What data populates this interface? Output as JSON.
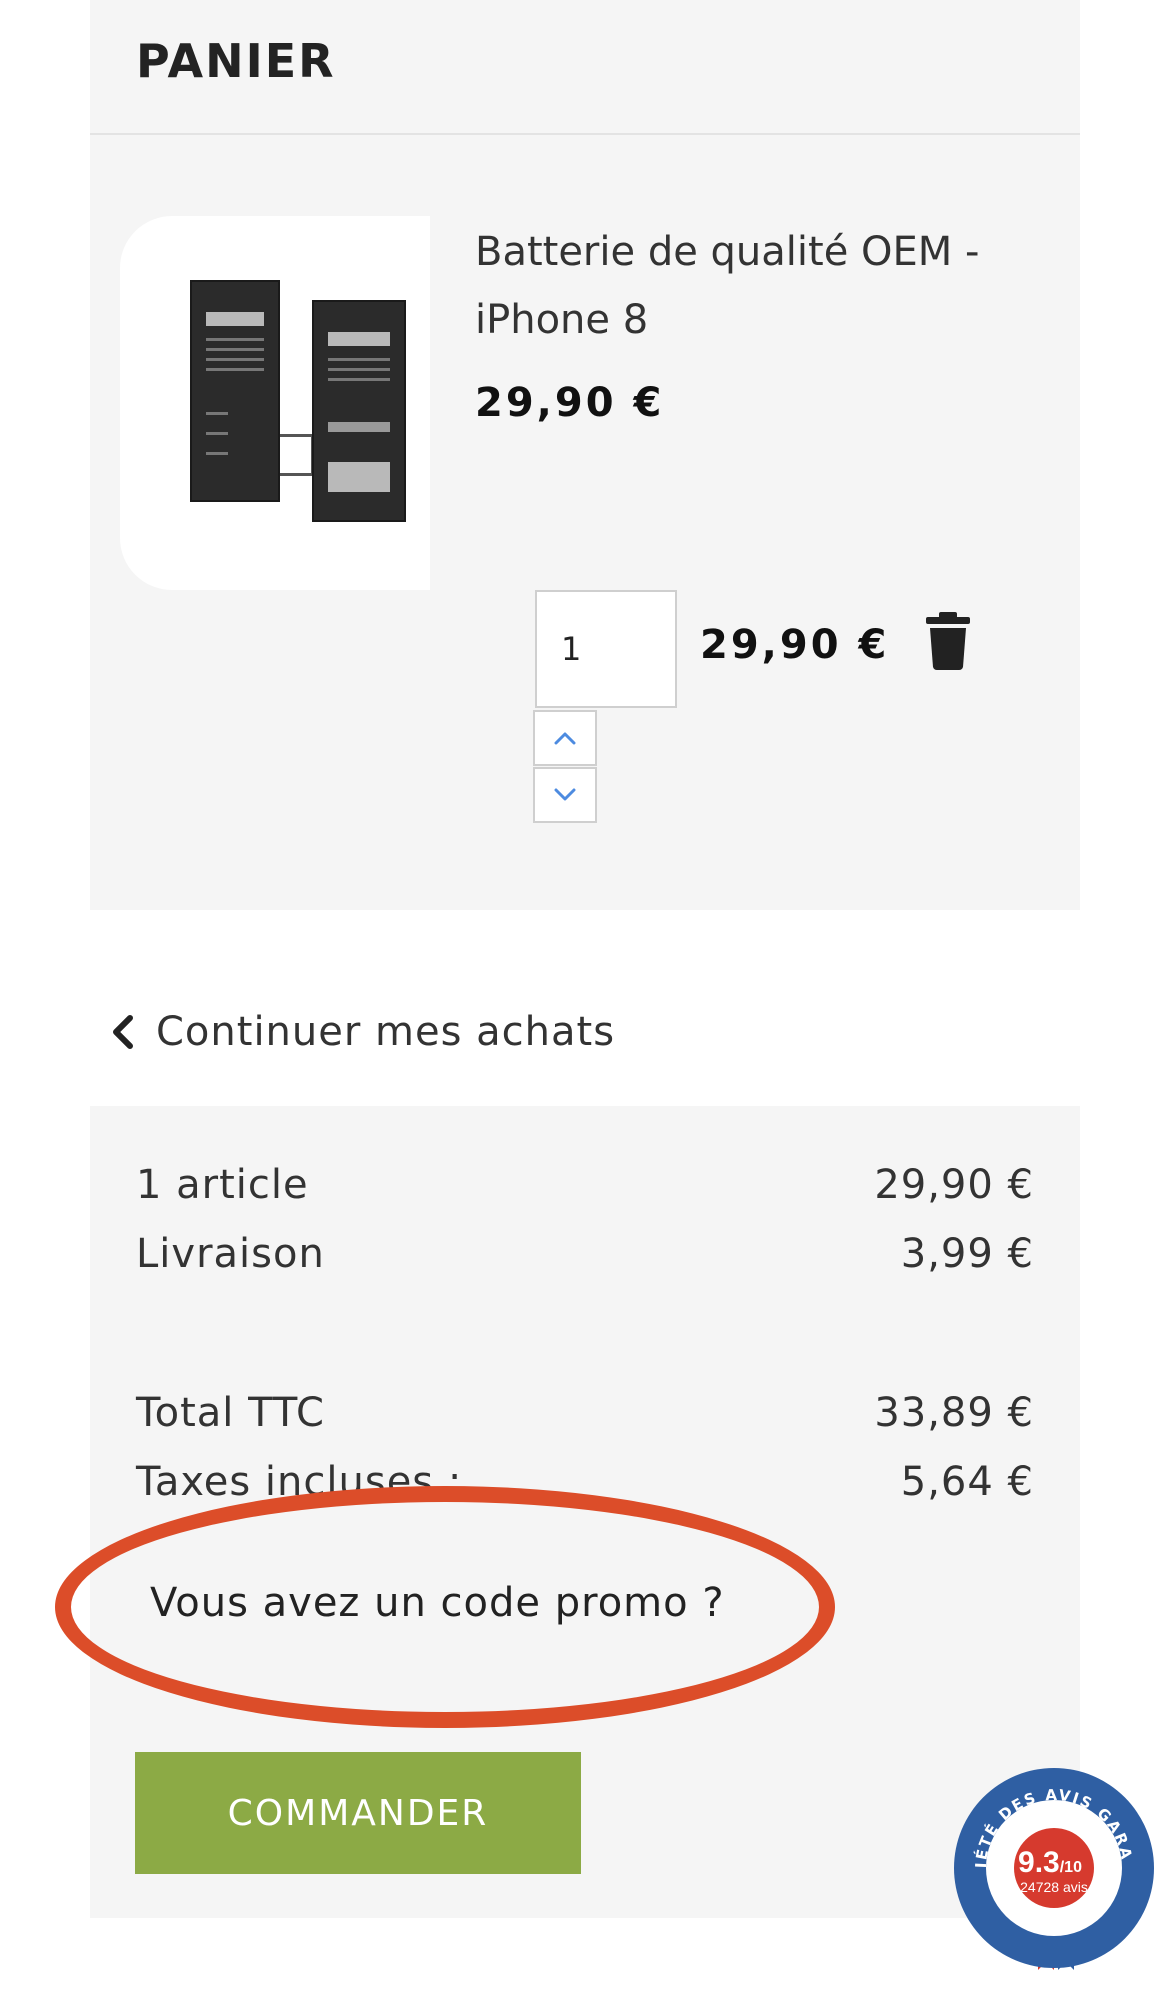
{
  "cart": {
    "title": "PANIER",
    "item": {
      "name": "Batterie de qualité OEM - iPhone 8",
      "unit_price": "29,90 €",
      "quantity": "1",
      "line_total": "29,90 €"
    }
  },
  "continue_shopping": "Continuer mes achats",
  "summary": {
    "items_label": "1 article",
    "items_value": "29,90 €",
    "shipping_label": "Livraison",
    "shipping_value": "3,99 €",
    "total_label": "Total TTC",
    "total_value": "33,89 €",
    "taxes_label": "Taxes incluses :",
    "taxes_value": "5,64 €"
  },
  "promo_link": "Vous avez un code promo ?",
  "order_button": "COMMANDER",
  "reviews_badge": {
    "arc_text": "SOCIÉTÉ DES AVIS GARANTIS",
    "score": "9.3",
    "score_suffix": "/10",
    "count": "24728 avis"
  },
  "colors": {
    "accent_green": "#8caa45",
    "highlight_red": "#dc4d29",
    "badge_blue": "#2f5fa3",
    "badge_red": "#d63a2e",
    "stepper_icon": "#4d8be0"
  },
  "icons": [
    "chevron-up-icon",
    "chevron-down-icon",
    "trash-icon",
    "chevron-left-icon"
  ]
}
